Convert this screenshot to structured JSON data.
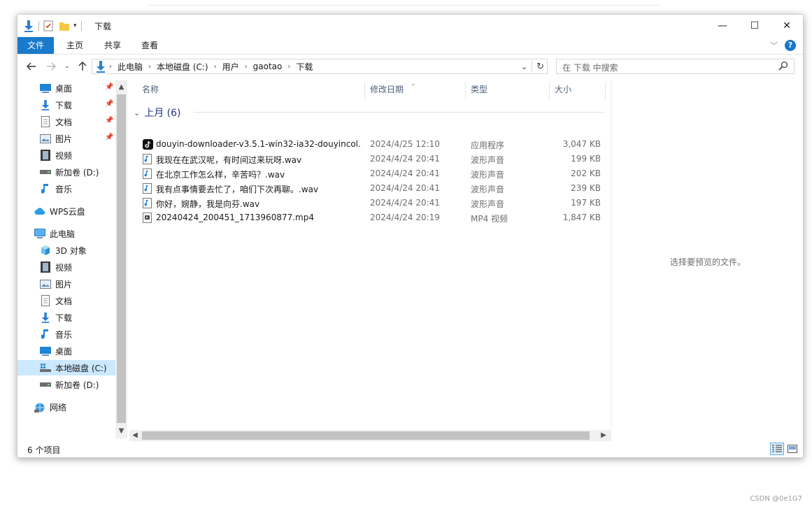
{
  "window": {
    "title": "下载",
    "minimize_glyph": "—",
    "maximize_glyph": "☐",
    "close_glyph": "✕"
  },
  "ribbon": {
    "tabs": [
      {
        "label": "文件",
        "active": true
      },
      {
        "label": "主页"
      },
      {
        "label": "共享"
      },
      {
        "label": "查看"
      }
    ]
  },
  "address": {
    "crumbs": [
      "此电脑",
      "本地磁盘 (C:)",
      "用户",
      "gaotao",
      "下载"
    ]
  },
  "search": {
    "placeholder": "在 下载 中搜索"
  },
  "sidebar": {
    "items": [
      {
        "label": "桌面",
        "icon": "desktop-icon",
        "pinned": true
      },
      {
        "label": "下载",
        "icon": "download-icon",
        "pinned": true
      },
      {
        "label": "文档",
        "icon": "document-icon",
        "pinned": true
      },
      {
        "label": "图片",
        "icon": "picture-icon",
        "pinned": true
      },
      {
        "label": "视频",
        "icon": "video-icon"
      },
      {
        "label": "新加卷 (D:)",
        "icon": "drive-icon"
      },
      {
        "label": "音乐",
        "icon": "music-icon"
      },
      {
        "label": "WPS云盘",
        "icon": "cloud-icon"
      },
      {
        "label": "此电脑",
        "icon": "computer-icon"
      },
      {
        "label": "3D 对象",
        "icon": "3d-objects-icon"
      },
      {
        "label": "视频",
        "icon": "video-icon"
      },
      {
        "label": "图片",
        "icon": "picture-icon"
      },
      {
        "label": "文档",
        "icon": "document-icon"
      },
      {
        "label": "下载",
        "icon": "download-icon"
      },
      {
        "label": "音乐",
        "icon": "music-icon"
      },
      {
        "label": "桌面",
        "icon": "desktop-icon"
      },
      {
        "label": "本地磁盘 (C:)",
        "icon": "system-drive-icon",
        "selected": true
      },
      {
        "label": "新加卷 (D:)",
        "icon": "drive-icon"
      },
      {
        "label": "网络",
        "icon": "network-icon"
      }
    ]
  },
  "columns": {
    "name": "名称",
    "date": "修改日期",
    "type": "类型",
    "size": "大小"
  },
  "group": {
    "label": "上月 (6)"
  },
  "files": [
    {
      "name": "douyin-downloader-v3.5.1-win32-ia32-douyincol...",
      "date": "2024/4/25 12:10",
      "type": "应用程序",
      "size": "3,047 KB",
      "icon": "tiktok-app-icon"
    },
    {
      "name": "我现在在武汉呢，有时间过来玩呀.wav",
      "date": "2024/4/24 20:41",
      "type": "波形声音",
      "size": "199 KB",
      "icon": "audio-file-icon"
    },
    {
      "name": "在北京工作怎么样，辛苦吗？.wav",
      "date": "2024/4/24 20:41",
      "type": "波形声音",
      "size": "202 KB",
      "icon": "audio-file-icon"
    },
    {
      "name": "我有点事情要去忙了，咱们下次再聊。.wav",
      "date": "2024/4/24 20:41",
      "type": "波形声音",
      "size": "239 KB",
      "icon": "audio-file-icon"
    },
    {
      "name": "你好，婉静，我是向芬.wav",
      "date": "2024/4/24 20:41",
      "type": "波形声音",
      "size": "197 KB",
      "icon": "audio-file-icon"
    },
    {
      "name": "20240424_200451_1713960877.mp4",
      "date": "2024/4/24 20:19",
      "type": "MP4 视频",
      "size": "1,847 KB",
      "icon": "video-file-icon"
    }
  ],
  "preview": {
    "text": "选择要预览的文件。"
  },
  "status": {
    "count": "6 个项目"
  },
  "watermark": "CSDN @0e1G7",
  "colors": {
    "accent": "#1979ca",
    "selection": "#cce8ff",
    "group_header": "#1e3287"
  }
}
